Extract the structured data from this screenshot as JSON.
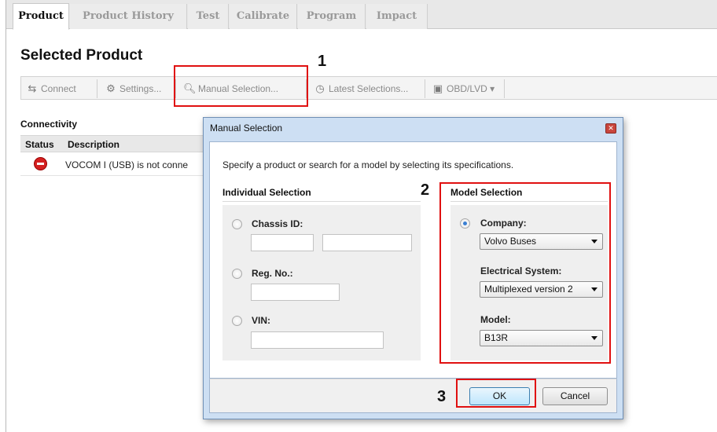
{
  "tabs": [
    {
      "label": "Product",
      "active": true
    },
    {
      "label": "Product History"
    },
    {
      "label": "Test"
    },
    {
      "label": "Calibrate"
    },
    {
      "label": "Program"
    },
    {
      "label": "Impact"
    }
  ],
  "page_title": "Selected Product",
  "toolbar": {
    "connect": "Connect",
    "settings": "Settings...",
    "manual_selection": "Manual Selection...",
    "latest_selections": "Latest Selections...",
    "obd": "OBD/LVD"
  },
  "annotations": {
    "one": "1",
    "two": "2",
    "three": "3"
  },
  "connectivity": {
    "label": "Connectivity",
    "columns": {
      "status": "Status",
      "description": "Description"
    },
    "row_text": "VOCOM I (USB) is not conne"
  },
  "dialog": {
    "title": "Manual Selection",
    "intro": "Specify a product or search for a model by selecting its specifications.",
    "individual": {
      "title": "Individual Selection",
      "chassis_label": "Chassis ID:",
      "reg_label": "Reg. No.:",
      "vin_label": "VIN:"
    },
    "model": {
      "title": "Model Selection",
      "company_label": "Company:",
      "company_value": "Volvo Buses",
      "electrical_label": "Electrical System:",
      "electrical_value": "Multiplexed version 2",
      "model_label": "Model:",
      "model_value": "B13R"
    },
    "ok": "OK",
    "cancel": "Cancel"
  },
  "colors": {
    "accent_red": "#e01010",
    "dialog_frame": "#cddff3"
  }
}
